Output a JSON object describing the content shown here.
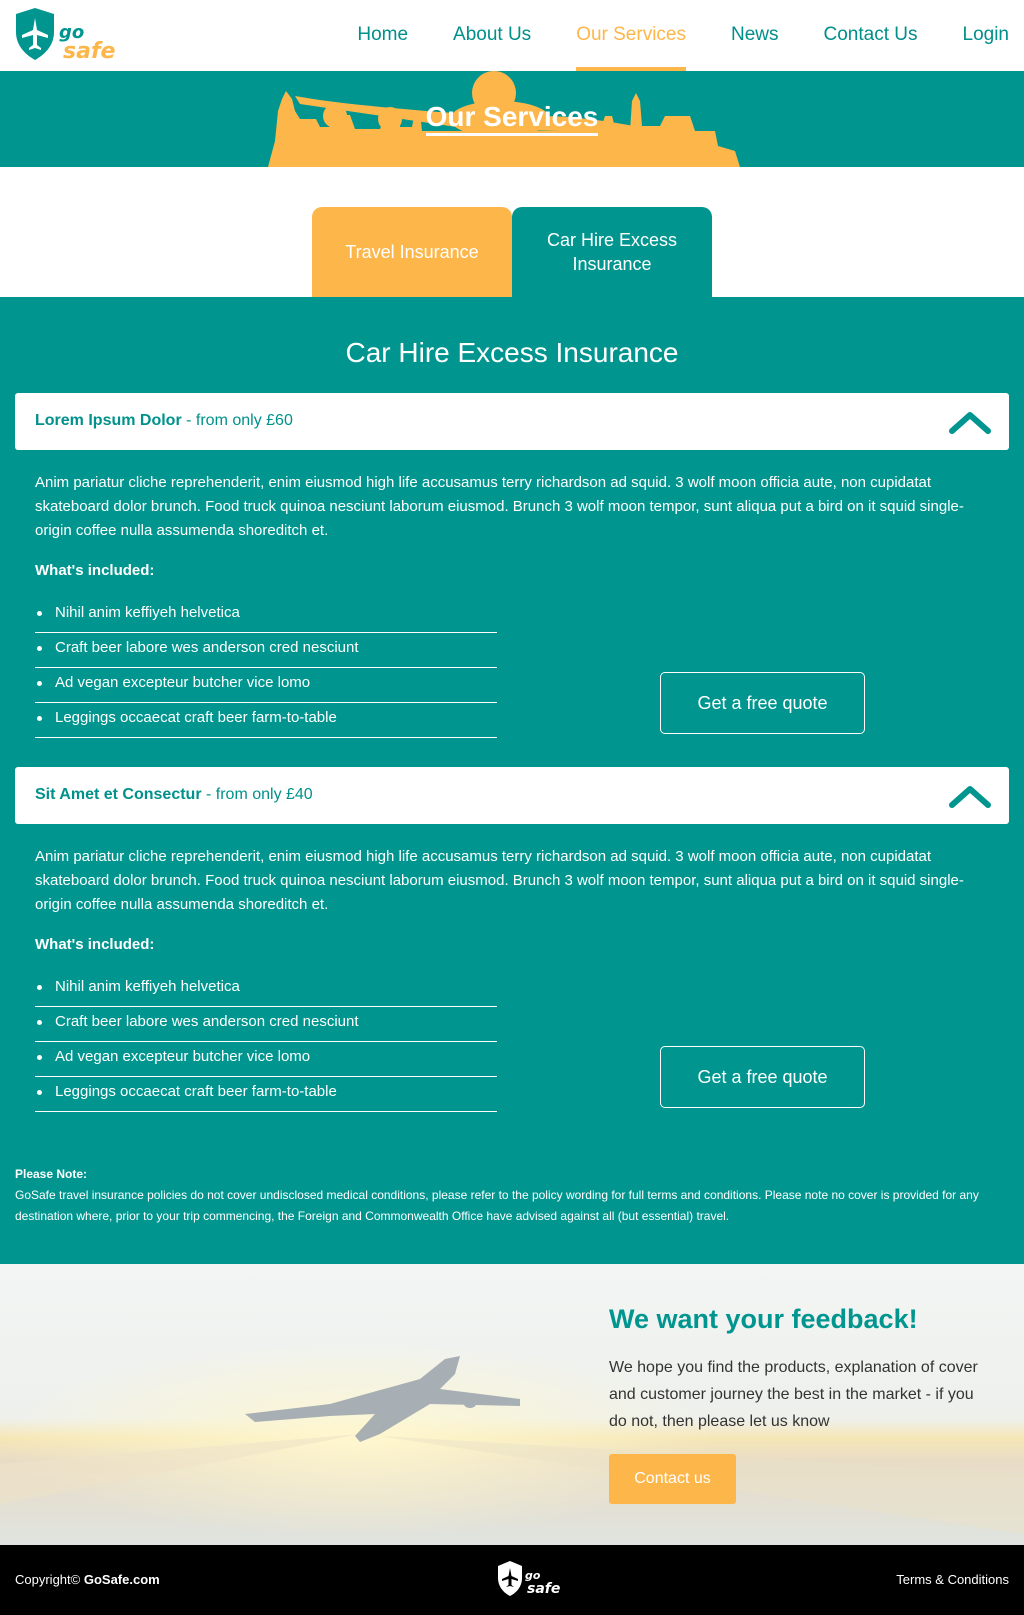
{
  "header": {
    "logo_text_top": "go",
    "logo_text_bottom": "safe",
    "nav": [
      {
        "label": "Home"
      },
      {
        "label": "About Us"
      },
      {
        "label": "Our Services"
      },
      {
        "label": "News"
      },
      {
        "label": "Contact Us"
      },
      {
        "label": "Login"
      }
    ],
    "active_nav": "Our Services"
  },
  "hero": {
    "title": "Our Services"
  },
  "tabs": [
    {
      "label": "Travel Insurance",
      "active": false
    },
    {
      "label": "Car Hire Excess Insurance",
      "active": true
    }
  ],
  "main": {
    "title": "Car Hire Excess Insurance",
    "policies": [
      {
        "name": "Lorem Ipsum Dolor",
        "price_text": " - from only £60",
        "description": "Anim pariatur cliche reprehenderit, enim eiusmod high life accusamus terry richardson ad squid. 3 wolf moon officia aute, non cupidatat skateboard dolor brunch. Food truck quinoa nesciunt laborum eiusmod. Brunch 3 wolf moon tempor, sunt aliqua put a bird on it squid single-origin coffee nulla assumenda shoreditch et.",
        "included_label": "What's included:",
        "items": [
          "Nihil anim keffiyeh helvetica",
          "Craft beer labore wes anderson cred nesciunt",
          "Ad vegan excepteur butcher vice lomo",
          "Leggings occaecat craft beer farm-to-table"
        ],
        "button": "Get a free quote"
      },
      {
        "name": "Sit Amet et Consectur",
        "price_text": " - from only £40",
        "description": "Anim pariatur cliche reprehenderit, enim eiusmod high life accusamus terry richardson ad squid. 3 wolf moon officia aute, non cupidatat skateboard dolor brunch. Food truck quinoa nesciunt laborum eiusmod. Brunch 3 wolf moon tempor, sunt aliqua put a bird on it squid single-origin coffee nulla assumenda shoreditch et.",
        "included_label": "What's included:",
        "items": [
          "Nihil anim keffiyeh helvetica",
          "Craft beer labore wes anderson cred nesciunt",
          "Ad vegan excepteur butcher vice lomo",
          "Leggings occaecat craft beer farm-to-table"
        ],
        "button": "Get a free quote"
      }
    ],
    "note_label": "Please Note:",
    "note_text": "GoSafe travel insurance policies do not cover undisclosed medical conditions, please refer to the policy wording for full terms and conditions. Please note no cover is provided for any destination where, prior to your trip commencing, the Foreign and Commonwealth Office have advised against all (but essential) travel."
  },
  "feedback": {
    "title": "We want your feedback!",
    "text": "We hope you find the products, explanation of cover and customer journey the best in the market - if you do not, then please let us know",
    "button": "Contact us"
  },
  "footer": {
    "copyright": "Copyright©",
    "brand": "GoSafe.com",
    "terms": "Terms & Conditions"
  },
  "colors": {
    "teal": "#00968f",
    "orange": "#fdb64a",
    "white": "#ffffff",
    "black": "#000000"
  },
  "icons": [
    "logo-shield-plane-icon",
    "chevron-up-icon"
  ]
}
